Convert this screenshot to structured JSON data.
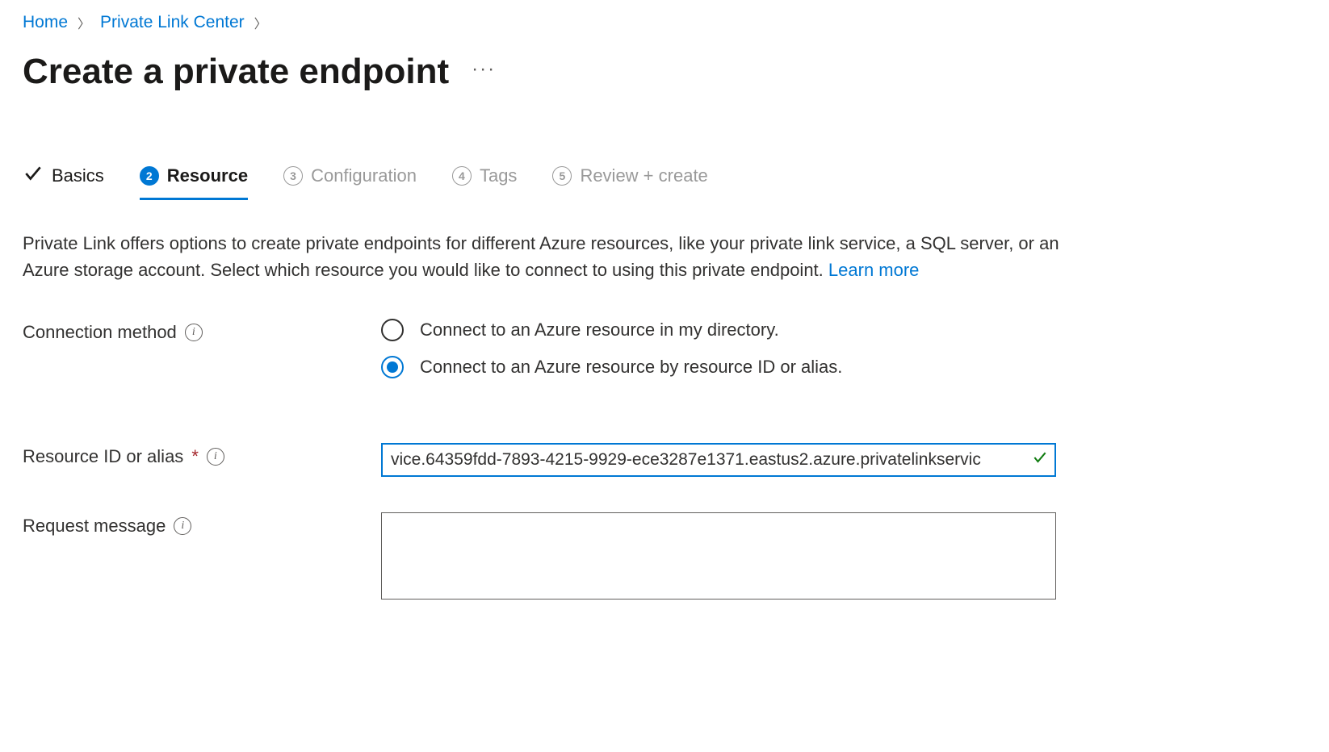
{
  "breadcrumb": {
    "home": "Home",
    "plc": "Private Link Center"
  },
  "page": {
    "title": "Create a private endpoint"
  },
  "tabs": {
    "basics": "Basics",
    "resource": "Resource",
    "configuration": "Configuration",
    "tags": "Tags",
    "review": "Review + create",
    "num2": "2",
    "num3": "3",
    "num4": "4",
    "num5": "5"
  },
  "description": {
    "text": "Private Link offers options to create private endpoints for different Azure resources, like your private link service, a SQL server, or an Azure storage account. Select which resource you would like to connect to using this private endpoint.  ",
    "learn_more": "Learn more"
  },
  "form": {
    "connection_method_label": "Connection method",
    "radio_directory": "Connect to an Azure resource in my directory.",
    "radio_resourceid": "Connect to an Azure resource by resource ID or alias.",
    "resource_id_label": "Resource ID or alias",
    "resource_id_value": "vice.64359fdd-7893-4215-9929-ece3287e1371.eastus2.azure.privatelinkservic",
    "request_message_label": "Request message",
    "request_message_value": ""
  }
}
